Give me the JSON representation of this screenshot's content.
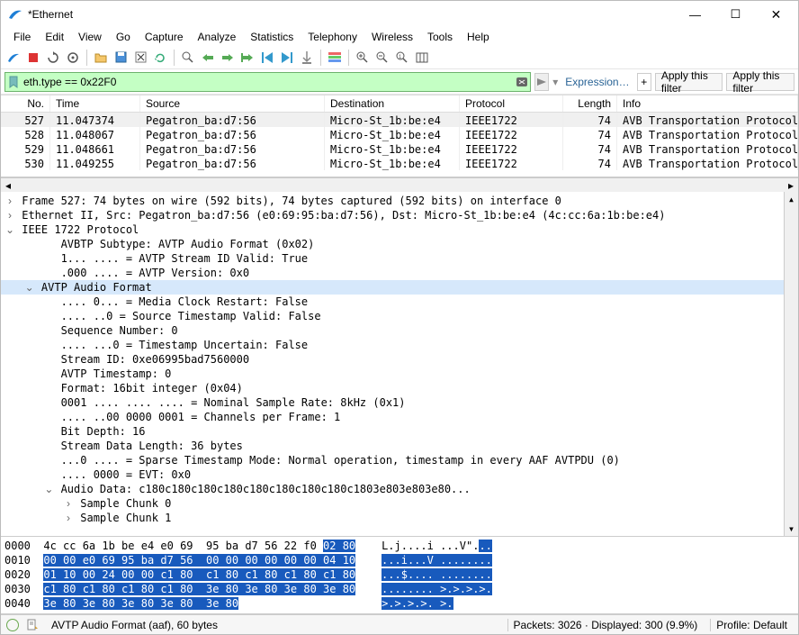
{
  "title": "*Ethernet",
  "menu": [
    "File",
    "Edit",
    "View",
    "Go",
    "Capture",
    "Analyze",
    "Statistics",
    "Telephony",
    "Wireless",
    "Tools",
    "Help"
  ],
  "filter": {
    "value": "eth.type == 0x22F0",
    "expression_link": "Expression…",
    "apply1": "Apply this filter",
    "apply2": "Apply this filter"
  },
  "columns": {
    "no": "No.",
    "time": "Time",
    "src": "Source",
    "dst": "Destination",
    "proto": "Protocol",
    "len": "Length",
    "info": "Info"
  },
  "rows": [
    {
      "no": "527",
      "time": "11.047374",
      "src": "Pegatron_ba:d7:56",
      "dst": "Micro-St_1b:be:e4",
      "proto": "IEEE1722",
      "len": "74",
      "info": "AVB Transportation Protocol"
    },
    {
      "no": "528",
      "time": "11.048067",
      "src": "Pegatron_ba:d7:56",
      "dst": "Micro-St_1b:be:e4",
      "proto": "IEEE1722",
      "len": "74",
      "info": "AVB Transportation Protocol"
    },
    {
      "no": "529",
      "time": "11.048661",
      "src": "Pegatron_ba:d7:56",
      "dst": "Micro-St_1b:be:e4",
      "proto": "IEEE1722",
      "len": "74",
      "info": "AVB Transportation Protocol"
    },
    {
      "no": "530",
      "time": "11.049255",
      "src": "Pegatron_ba:d7:56",
      "dst": "Micro-St_1b:be:e4",
      "proto": "IEEE1722",
      "len": "74",
      "info": "AVB Transportation Protocol"
    }
  ],
  "tree": [
    {
      "exp": ">",
      "ind": 0,
      "text": "Frame 527: 74 bytes on wire (592 bits), 74 bytes captured (592 bits) on interface 0"
    },
    {
      "exp": ">",
      "ind": 0,
      "text": "Ethernet II, Src: Pegatron_ba:d7:56 (e0:69:95:ba:d7:56), Dst: Micro-St_1b:be:e4 (4c:cc:6a:1b:be:e4)"
    },
    {
      "exp": "v",
      "ind": 0,
      "text": "IEEE 1722 Protocol"
    },
    {
      "exp": "",
      "ind": 2,
      "text": "AVBTP Subtype: AVTP Audio Format (0x02)"
    },
    {
      "exp": "",
      "ind": 2,
      "text": "1... .... = AVTP Stream ID Valid: True"
    },
    {
      "exp": "",
      "ind": 2,
      "text": ".000 .... = AVTP Version: 0x0"
    },
    {
      "exp": "v",
      "ind": 1,
      "text": "AVTP Audio Format",
      "sel": true
    },
    {
      "exp": "",
      "ind": 2,
      "text": ".... 0... = Media Clock Restart: False"
    },
    {
      "exp": "",
      "ind": 2,
      "text": ".... ..0 = Source Timestamp Valid: False"
    },
    {
      "exp": "",
      "ind": 2,
      "text": "Sequence Number: 0"
    },
    {
      "exp": "",
      "ind": 2,
      "text": ".... ...0 = Timestamp Uncertain: False"
    },
    {
      "exp": "",
      "ind": 2,
      "text": "Stream ID: 0xe06995bad7560000"
    },
    {
      "exp": "",
      "ind": 2,
      "text": "AVTP Timestamp: 0"
    },
    {
      "exp": "",
      "ind": 2,
      "text": "Format: 16bit integer (0x04)"
    },
    {
      "exp": "",
      "ind": 2,
      "text": "0001 .... .... .... = Nominal Sample Rate: 8kHz (0x1)"
    },
    {
      "exp": "",
      "ind": 2,
      "text": ".... ..00 0000 0001 = Channels per Frame: 1"
    },
    {
      "exp": "",
      "ind": 2,
      "text": "Bit Depth: 16"
    },
    {
      "exp": "",
      "ind": 2,
      "text": "Stream Data Length: 36 bytes"
    },
    {
      "exp": "",
      "ind": 2,
      "text": "...0 .... = Sparse Timestamp Mode: Normal operation, timestamp in every AAF AVTPDU (0)"
    },
    {
      "exp": "",
      "ind": 2,
      "text": ".... 0000 = EVT: 0x0"
    },
    {
      "exp": "v",
      "ind": 2,
      "text": "Audio Data: c180c180c180c180c180c180c180c180c1803e803e803e80..."
    },
    {
      "exp": ">",
      "ind": 3,
      "text": "Sample Chunk 0"
    },
    {
      "exp": ">",
      "ind": 3,
      "text": "Sample Chunk 1"
    }
  ],
  "hex": [
    {
      "off": "0000",
      "p": "4c cc 6a 1b be e4 e0 69  95 ba d7 56 22 f0 ",
      "s": "02 80",
      "a1": "L.j....i ...V\".",
      "a2": ".."
    },
    {
      "off": "0010",
      "p": "",
      "s": "00 00 e0 69 95 ba d7 56  00 00 00 00 00 00 04 10",
      "a1": "",
      "a2": "...i...V ........"
    },
    {
      "off": "0020",
      "p": "",
      "s": "01 10 00 24 00 00 c1 80  c1 80 c1 80 c1 80 c1 80",
      "a1": "",
      "a2": "...$.... ........"
    },
    {
      "off": "0030",
      "p": "",
      "s": "c1 80 c1 80 c1 80 c1 80  3e 80 3e 80 3e 80 3e 80",
      "a1": "",
      "a2": "........ >.>.>.>."
    },
    {
      "off": "0040",
      "p": "",
      "s": "3e 80 3e 80 3e 80 3e 80  3e 80",
      "a1": "",
      "a2": ">.>.>.>. >."
    }
  ],
  "status": {
    "field": "AVTP Audio Format (aaf), 60 bytes",
    "packets": "Packets: 3026 · Displayed: 300 (9.9%)",
    "profile": "Profile: Default"
  }
}
